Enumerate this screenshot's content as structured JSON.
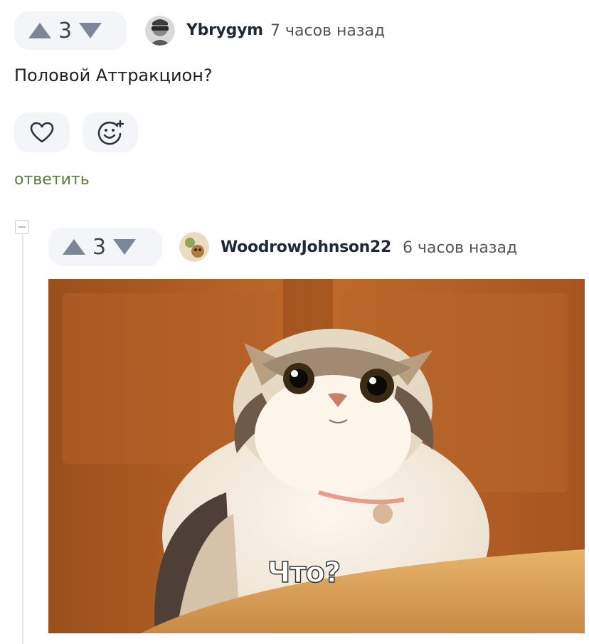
{
  "comment1": {
    "votes": "3",
    "username": "Ybrygym",
    "time": "7 часов назад",
    "text": "Половой Аттракцион?",
    "reply_label": "ответить"
  },
  "comment2": {
    "votes": "3",
    "username": "WoodrowJohnson22",
    "time": "6 часов назад",
    "image_caption": "Что?"
  },
  "icons": {
    "upvote": "triangle-up-icon",
    "downvote": "triangle-down-icon",
    "like": "heart-icon",
    "react": "smiley-add-icon",
    "collapse": "minus-square-icon"
  },
  "colors": {
    "pill_bg": "#f3f5f9",
    "arrow": "#7b8796",
    "reply": "#5b7d3c"
  }
}
